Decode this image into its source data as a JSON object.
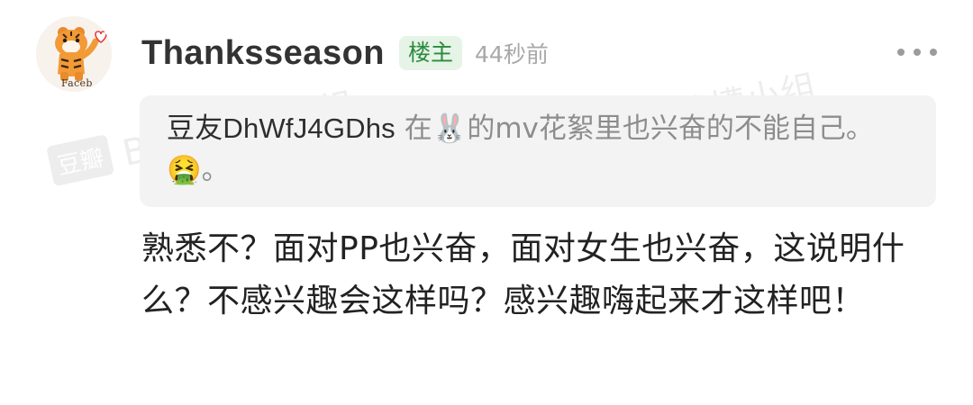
{
  "author": {
    "name": "Thanksseason",
    "badge": "楼主",
    "time": "44秒前",
    "avatar_brand": "Faceb"
  },
  "quote": {
    "author": "豆友DhWfJ4GDhs",
    "text_before_emoji": " 在",
    "text_after_emoji": "的mv花絮里也兴奋的不能自己。",
    "text_end": "。",
    "emoji_1": "🐰",
    "emoji_2": "🤮"
  },
  "body": {
    "text": "熟悉不？面对PP也兴奋，面对女生也兴奋，这说明什么？不感兴趣会这样吗？感兴趣嗨起来才这样吧！"
  },
  "watermark": {
    "logo": "豆瓣",
    "text": "BKPP吐槽小组"
  },
  "colors": {
    "badge_bg": "#e5f4e6",
    "badge_text": "#2d8a3e",
    "quote_bg": "#f3f3f3"
  },
  "icons": {
    "more": "more-horizontal-icon"
  }
}
